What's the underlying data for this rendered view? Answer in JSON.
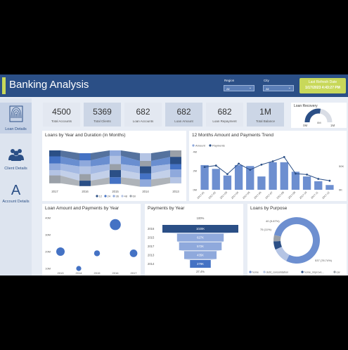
{
  "header": {
    "title": "Banking Analysis",
    "region_label": "Region",
    "region_value": "All",
    "city_label": "City",
    "city_value": "All",
    "refresh_label": "Last Refresh Date",
    "refresh_value": "1/17/2023 4:43:27 PM"
  },
  "sidebar": {
    "items": [
      {
        "label": "Loan Details",
        "icon": "fingerprint-icon"
      },
      {
        "label": "Client Details",
        "icon": "people-icon"
      },
      {
        "label": "Account Details",
        "icon": "letter-a-icon"
      }
    ]
  },
  "kpis": [
    {
      "value": "4500",
      "label": "Total Accounts"
    },
    {
      "value": "5369",
      "label": "Total Clients"
    },
    {
      "value": "682",
      "label": "Loan Accounts"
    },
    {
      "value": "682",
      "label": "Loan Amount"
    },
    {
      "value": "682",
      "label": "Loan Repayment"
    },
    {
      "value": "1M",
      "label": "Total Balance"
    }
  ],
  "gauge": {
    "title": "Loan Recovery",
    "min": "0M",
    "max": "1M",
    "value_label": "0M",
    "fraction": 0.55
  },
  "colors": {
    "primary": "#2b4f86",
    "accent": "#c8d85a",
    "mid_blue": "#4472c4",
    "light_blue": "#8fa9dc",
    "bg": "#e8edf5"
  },
  "ribbon": {
    "title": "Loans by Year and Duration (in Months)",
    "x_ticks": [
      "2017",
      "2016",
      "2015",
      "2014",
      "2013"
    ],
    "legend": [
      "12",
      "24",
      "36",
      "48",
      "60"
    ]
  },
  "trend": {
    "title": "12 Months Amount and Payments Trend",
    "legend": [
      "Amount",
      "Payments"
    ],
    "left_ticks": [
      "4M",
      "2M",
      "0M"
    ],
    "right_ticks": [
      "50K",
      "0K"
    ]
  },
  "bubble": {
    "title": "Loan Amount and Payments by Year",
    "y_ticks": [
      "40M",
      "30M",
      "20M",
      "10M"
    ],
    "x_ticks": [
      "2013",
      "2014",
      "2015",
      "2016",
      "2017"
    ]
  },
  "funnel": {
    "title": "Payments by Year",
    "top_pct": "100%",
    "bottom_pct": "27.4%"
  },
  "donut": {
    "title": "Loans by Purpose",
    "labels": [
      "40 (5.87%)",
      "75 (11%)",
      "537 (78.74%)"
    ],
    "legend": [
      "home",
      "debt_consolidation",
      "home_improve...",
      "car"
    ]
  },
  "chart_data": [
    {
      "type": "line",
      "title": "12 Months Amount and Payments Trend",
      "categories": [
        "2017-01",
        "2017-02",
        "2017-03",
        "2017-04",
        "2017-05",
        "2017-06",
        "2017-07",
        "2017-08",
        "2017-09",
        "2017-10",
        "2017-11",
        "2017-12"
      ],
      "series": [
        {
          "name": "Amount",
          "kind": "bar",
          "values": [
            2.6,
            2.2,
            1.5,
            2.6,
            2.5,
            1.4,
            2.9,
            2.9,
            1.9,
            1.4,
            0.9,
            0.5
          ]
        },
        {
          "name": "Payments",
          "kind": "line",
          "values": [
            48,
            51,
            33,
            55,
            42,
            53,
            60,
            69,
            34,
            32,
            23,
            19
          ]
        }
      ],
      "ylim": [
        0,
        4
      ],
      "y2lim": [
        0,
        80
      ]
    },
    {
      "type": "scatter",
      "title": "Loan Amount and Payments by Year",
      "x": [
        "2013",
        "2014",
        "2015",
        "2016",
        "2017"
      ],
      "y": [
        20,
        10,
        19,
        36,
        19
      ],
      "sizes": [
        1,
        0.6,
        0.7,
        1.3,
        0.9
      ],
      "ylim": [
        10,
        40
      ]
    },
    {
      "type": "bar",
      "title": "Payments by Year",
      "categories": [
        "2016",
        "2015",
        "2017",
        "2013",
        "2014"
      ],
      "values": [
        "1020K",
        "627K",
        "572K",
        "435K",
        "279K"
      ],
      "numeric": [
        1020,
        627,
        572,
        435,
        279
      ]
    },
    {
      "type": "pie",
      "title": "Loans by Purpose",
      "categories": [
        "home",
        "debt_consolidation",
        "home_improve...",
        "car"
      ],
      "values": [
        537,
        75,
        40,
        30
      ]
    }
  ]
}
